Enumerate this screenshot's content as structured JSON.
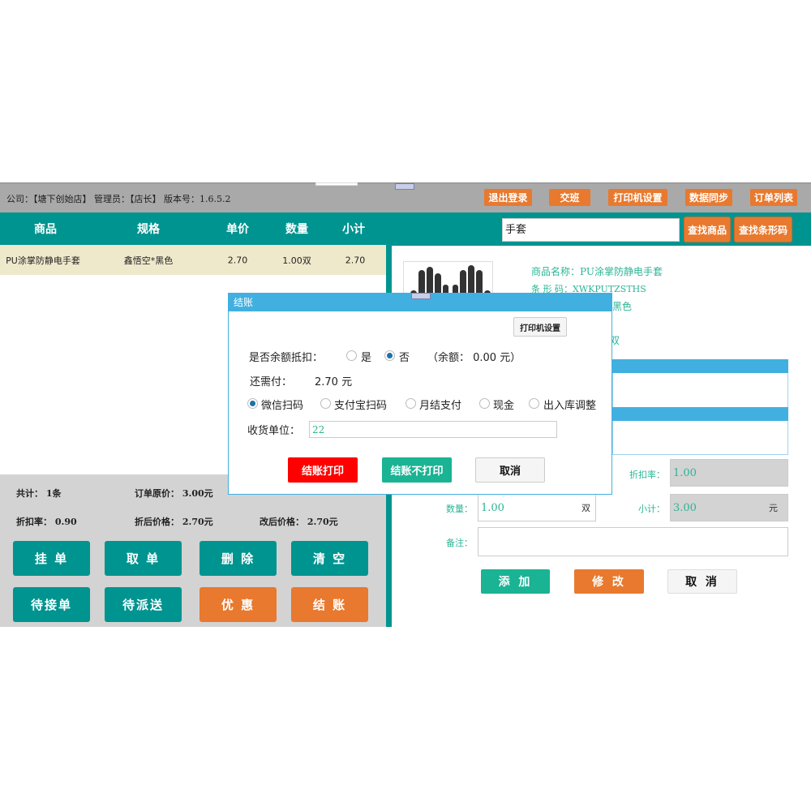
{
  "topbar": {
    "info": "公司：【塘下创始店】 管理员：【店长】 版本号：1.6.5.2",
    "buttons": [
      "退出登录",
      "交班",
      "打印机设置",
      "数据同步",
      "订单列表"
    ]
  },
  "cart": {
    "columns": [
      "商品",
      "规格",
      "单价",
      "数量",
      "小计"
    ],
    "rows": [
      [
        "PU涂掌防静电手套",
        "鑫悟空*黑色",
        "2.70",
        "1.00双",
        "2.70"
      ]
    ]
  },
  "summary": {
    "total_label": "共计：",
    "total_value": "1条",
    "orig_label": "订单原价：",
    "orig_value": "3.00元",
    "rate_label": "折扣率：",
    "rate_value": "0.90",
    "disc_label": "折后价格：",
    "disc_value": "2.70元",
    "mod_label": "改后价格：",
    "mod_value": "2.70元"
  },
  "actions": [
    "挂 单",
    "取 单",
    "删 除",
    "清 空",
    "待接单",
    "待派送",
    "优 惠",
    "结 账"
  ],
  "search": {
    "value": "手套",
    "find_product": "查找商品",
    "find_barcode": "查找条形码"
  },
  "product": {
    "name": "商品名称：PU涂掌防静电手套",
    "barcode": "条 形 码：XWKPUTZSTHS",
    "spec_tail": "黑色",
    "unit_tail": "双"
  },
  "form": {
    "rate_label": "折扣率：",
    "rate_value": "1.00",
    "qty_label": "数量：",
    "qty_value": "1.00",
    "qty_unit": "双",
    "sub_label": "小计：",
    "sub_value": "3.00",
    "sub_unit": "元",
    "note_label": "备注：",
    "note_value": "",
    "add": "添 加",
    "edit": "修 改",
    "cancel": "取 消"
  },
  "dialog": {
    "title": "结账",
    "printer": "打印机设置",
    "balance_label": "是否余额抵扣：",
    "yes": "是",
    "no": "否",
    "balance_note": "（余额：  0.00 元）",
    "balance_choice": "否",
    "due_label": "还需付：",
    "due_value": "2.70 元",
    "payments": [
      "微信扫码",
      "支付宝扫码",
      "月结支付",
      "现金",
      "出入库调整"
    ],
    "payment_selected": "微信扫码",
    "receiver_label": "收货单位：",
    "receiver_value": "22",
    "pay_print": "结账打印",
    "pay_noprint": "结账不打印",
    "cancel": "取消"
  },
  "colors": {
    "teal": "#009490",
    "orange": "#e8792e",
    "blue": "#41b0e0",
    "red": "#ff0000",
    "green": "#1ab394"
  }
}
